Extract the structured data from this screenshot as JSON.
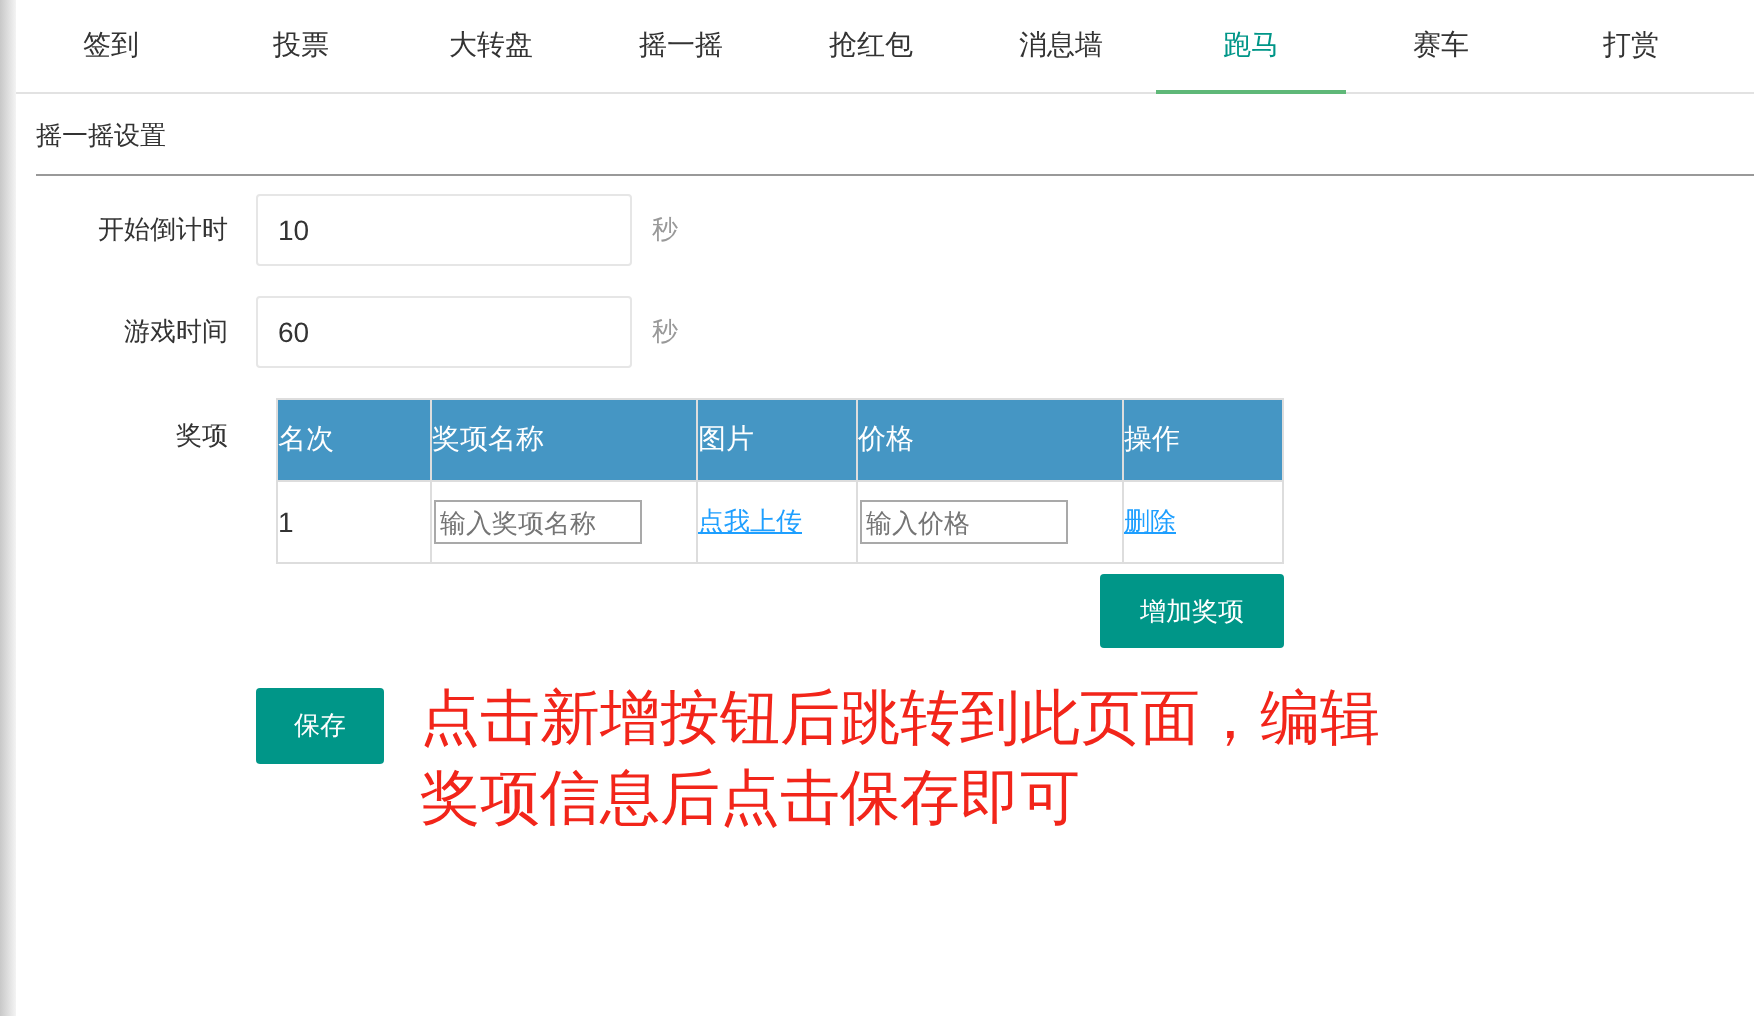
{
  "tabs": [
    {
      "label": "签到",
      "selected": false
    },
    {
      "label": "投票",
      "selected": false
    },
    {
      "label": "大转盘",
      "selected": false
    },
    {
      "label": "摇一摇",
      "selected": false
    },
    {
      "label": "抢红包",
      "selected": false
    },
    {
      "label": "消息墙",
      "selected": false
    },
    {
      "label": "跑马",
      "selected": true
    },
    {
      "label": "赛车",
      "selected": false
    },
    {
      "label": "打赏",
      "selected": false
    }
  ],
  "section_title": "摇一摇设置",
  "fields": [
    {
      "label": "开始倒计时",
      "value": "10",
      "unit": "秒"
    },
    {
      "label": "游戏时间",
      "value": "60",
      "unit": "秒"
    }
  ],
  "prizes": {
    "label": "奖项",
    "columns": [
      "名次",
      "奖项名称",
      "图片",
      "价格",
      "操作"
    ],
    "rows": [
      {
        "rank": "1",
        "name_placeholder": "输入奖项名称",
        "upload_link": "点我上传",
        "price_placeholder": "输入价格",
        "delete_link": "删除"
      }
    ],
    "add_button": "增加奖项"
  },
  "save_button": "保存",
  "annotation": "点击新增按钮后跳转到此页面，编辑奖项信息后点击保存即可"
}
